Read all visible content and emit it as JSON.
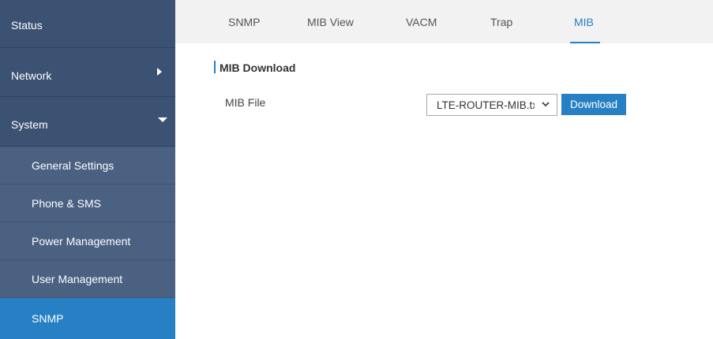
{
  "sidebar": {
    "items": [
      {
        "label": "Status"
      },
      {
        "label": "Network"
      },
      {
        "label": "System"
      }
    ],
    "subitems": [
      {
        "label": "General Settings"
      },
      {
        "label": "Phone & SMS"
      },
      {
        "label": "Power Management"
      },
      {
        "label": "User Management"
      },
      {
        "label": "SNMP"
      }
    ]
  },
  "tabs": [
    {
      "label": "SNMP"
    },
    {
      "label": "MIB View"
    },
    {
      "label": "VACM"
    },
    {
      "label": "Trap"
    },
    {
      "label": "MIB"
    }
  ],
  "active_tab": "MIB",
  "section": {
    "title": "MIB Download"
  },
  "form": {
    "mib_file_label": "MIB File",
    "mib_file_value": "LTE-ROUTER-MIB.txt",
    "download_label": "Download"
  },
  "icons": {
    "network_arrow": "chevron-right-icon",
    "system_arrow": "chevron-down-icon",
    "select_arrow": "chevron-down-icon"
  },
  "colors": {
    "sidebar_bg": "#3c5272",
    "submenu_bg": "#4a6182",
    "accent": "#2680c3"
  }
}
